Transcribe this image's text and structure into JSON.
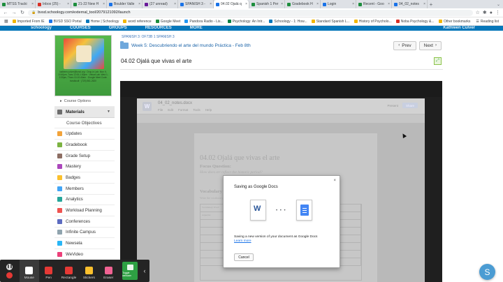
{
  "browser": {
    "tabs": [
      {
        "label": "MTSS Tracki",
        "color": "#1e8e3e"
      },
      {
        "label": "Inbox (25) -",
        "color": "#d93025"
      },
      {
        "label": "21-22 New H",
        "color": "#1e8e3e"
      },
      {
        "label": "Boulder Valle",
        "color": "#1a73e8"
      },
      {
        "label": "(27 unread)",
        "color": "#6a1b9a"
      },
      {
        "label": "SPANISH 3 -",
        "color": "#1a73e8"
      },
      {
        "label": "04.02 Ojalá q",
        "color": "#1a73e8",
        "active": true
      },
      {
        "label": "Spanish 1 Per",
        "color": "#1e8e3e"
      },
      {
        "label": "Gradebook H",
        "color": "#1e8e3e"
      },
      {
        "label": "Login",
        "color": "#1a73e8"
      },
      {
        "label": "Recent - Goo",
        "color": "#1e8e3e"
      },
      {
        "label": "04_02_notes",
        "color": "#1a73e8"
      }
    ],
    "url": "bvsd.schoology.com/external_tool/2079121092/launch",
    "bookmarks": [
      {
        "label": "Imported From IE",
        "color": "#f2b600"
      },
      {
        "label": "BVSD SSO Portal",
        "color": "#1a73e8"
      },
      {
        "label": "Home | Schoology",
        "color": "#0677ba"
      },
      {
        "label": "word reference",
        "color": "#f2b600"
      },
      {
        "label": "Google Meet",
        "color": "#1e8e3e"
      },
      {
        "label": "Pandora Radio - Lis...",
        "color": "#2196f3"
      },
      {
        "label": "Psychology: An Intr...",
        "color": "#0b8043"
      },
      {
        "label": "Schoology - 1: How...",
        "color": "#0677ba"
      },
      {
        "label": "Standard Spanish L...",
        "color": "#f2b600"
      },
      {
        "label": "History of Psycholo...",
        "color": "#f2b600"
      },
      {
        "label": "Noba Psychology &...",
        "color": "#d93025"
      }
    ],
    "other_bookmarks": "Other bookmarks",
    "reading_list": "Reading list"
  },
  "schoology_nav": {
    "items": [
      "schoology",
      "COURSES",
      "GROUPS",
      "RESOURCES",
      "MORE"
    ],
    "user": "Kathleen Culver"
  },
  "sidebar": {
    "image_caption": "katheen.culver@bvsd.org · Drop-in Lab: Mon 9-10:40pm, Tues 12:00-1:30pm · Virtual Lab: Wed 1-2:30pm, Thurs 10-10:40am · Google Meet Code: bvsdkcult · (720) 561-2620",
    "course_options": "Course Options",
    "materials": "Materials",
    "menu": [
      {
        "label": "Course Objectives",
        "sub": true
      },
      {
        "label": "Updates"
      },
      {
        "label": "Gradebook"
      },
      {
        "label": "Grade Setup"
      },
      {
        "label": "Mastery"
      },
      {
        "label": "Badges"
      },
      {
        "label": "Members"
      },
      {
        "label": "Analytics"
      },
      {
        "label": "Workload Planning"
      },
      {
        "label": "Conferences"
      },
      {
        "label": "Infinite Campus"
      },
      {
        "label": "Newsela"
      },
      {
        "label": "WeVideo"
      }
    ]
  },
  "main": {
    "breadcrumb": "SPANISH 3: OF73B 1 SPANISH 3",
    "week_title": "Week 5: Descubriendo el arte del mundo Práctica - Feb 8th",
    "prev": "Prev",
    "next": "Next",
    "page_title": "04.02 Ojalá que vivas el arte"
  },
  "word": {
    "doc_name": "04_02_notes.docx",
    "menus": [
      "File",
      "Edit",
      "Format",
      "Tools",
      "Help"
    ],
    "present": "Present",
    "share": "Share",
    "heading": "04.02 Ojalá que vivas el arte",
    "focus_label": "Focus Question:",
    "focus_text": "How does art reflect the historic period?",
    "vocab_label": "Vocabulary",
    "vocab_note": "Write the vocabulary term, a definition, and an example sentence.",
    "table_rows": [
      [
        "Vocabulary Word",
        "",
        ""
      ],
      [
        "esquema",
        "",
        ""
      ],
      [
        "",
        "",
        ""
      ],
      [
        "",
        "",
        ""
      ],
      [
        "",
        "",
        ""
      ],
      [
        "",
        "",
        ""
      ],
      [
        "",
        "",
        ""
      ],
      [
        "",
        "",
        ""
      ]
    ]
  },
  "modal": {
    "title": "Saving as Google Docs",
    "message": "Saving a new version of your document as Google Docs",
    "learn_more": "Learn more",
    "cancel": "Cancel"
  },
  "annotation_toolbar": {
    "tools": [
      {
        "label": "Mouse",
        "color": "#ffffff",
        "selected": true
      },
      {
        "label": "Pen",
        "color": "#e53935"
      },
      {
        "label": "Rectangle",
        "color": "#e53935"
      },
      {
        "label": "Stickers",
        "color": "#fbc02d"
      },
      {
        "label": "Eraser",
        "color": "#f06292"
      }
    ],
    "green_label": "Toggle webcam"
  },
  "fab_letter": "S"
}
